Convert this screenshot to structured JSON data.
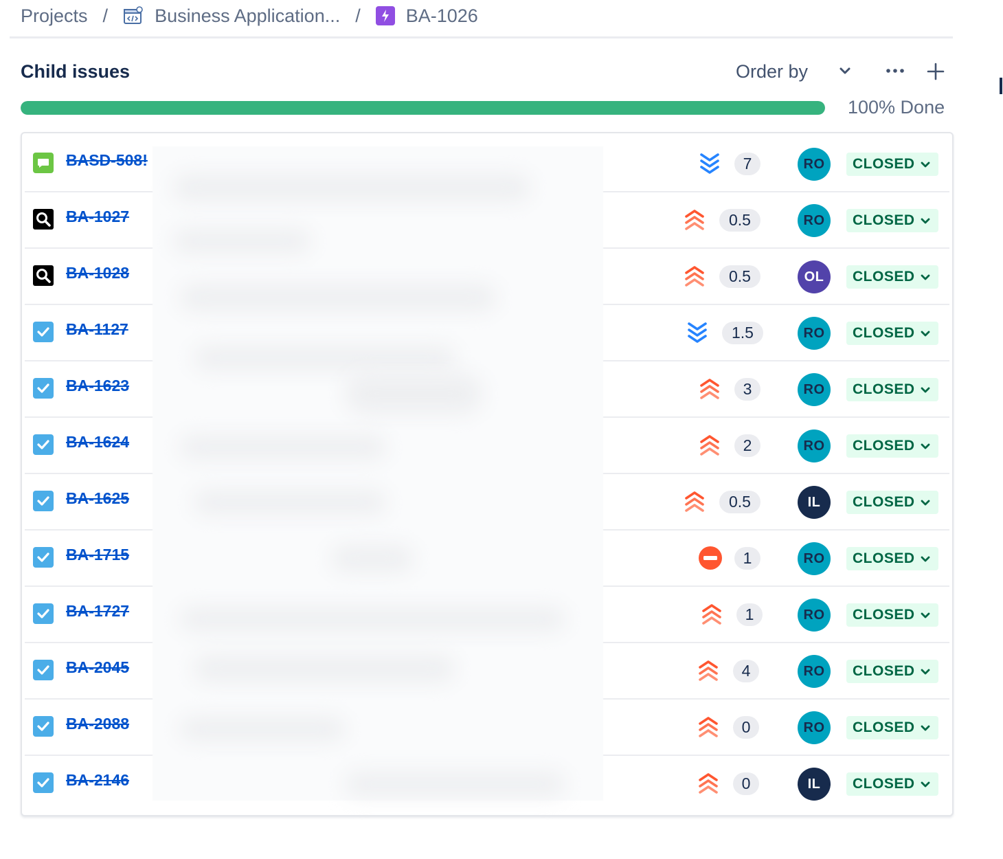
{
  "breadcrumb": {
    "projects": "Projects",
    "separator": "/",
    "project": "Business Application...",
    "issue": "BA-1026"
  },
  "child_issues": {
    "title": "Child issues",
    "order_by": "Order by",
    "progress_percent": 100,
    "progress_label": "100% Done",
    "colors": {
      "progress": "#36b37e",
      "status_bg": "#e3fcef",
      "status_text": "#006644",
      "link": "#0052cc"
    }
  },
  "rows": [
    {
      "key": "BASD-508!",
      "type": "request-icon",
      "priority": "lowest",
      "points": "7",
      "assignee": "RO",
      "status": "CLOSED"
    },
    {
      "key": "BA-1027",
      "type": "research-icon",
      "priority": "highest",
      "points": "0.5",
      "assignee": "RO",
      "status": "CLOSED"
    },
    {
      "key": "BA-1028",
      "type": "research-icon",
      "priority": "highest",
      "points": "0.5",
      "assignee": "OL",
      "status": "CLOSED"
    },
    {
      "key": "BA-1127",
      "type": "task-icon",
      "priority": "lowest",
      "points": "1.5",
      "assignee": "RO",
      "status": "CLOSED"
    },
    {
      "key": "BA-1623",
      "type": "task-icon",
      "priority": "highest",
      "points": "3",
      "assignee": "RO",
      "status": "CLOSED"
    },
    {
      "key": "BA-1624",
      "type": "task-icon",
      "priority": "highest",
      "points": "2",
      "assignee": "RO",
      "status": "CLOSED"
    },
    {
      "key": "BA-1625",
      "type": "task-icon",
      "priority": "highest",
      "points": "0.5",
      "assignee": "IL",
      "status": "CLOSED"
    },
    {
      "key": "BA-1715",
      "type": "task-icon",
      "priority": "blocker",
      "points": "1",
      "assignee": "RO",
      "status": "CLOSED"
    },
    {
      "key": "BA-1727",
      "type": "task-icon",
      "priority": "highest",
      "points": "1",
      "assignee": "RO",
      "status": "CLOSED"
    },
    {
      "key": "BA-2045",
      "type": "task-icon",
      "priority": "highest",
      "points": "4",
      "assignee": "RO",
      "status": "CLOSED"
    },
    {
      "key": "BA-2088",
      "type": "task-icon",
      "priority": "highest",
      "points": "0",
      "assignee": "RO",
      "status": "CLOSED"
    },
    {
      "key": "BA-2146",
      "type": "task-icon",
      "priority": "highest",
      "points": "0",
      "assignee": "IL",
      "status": "CLOSED"
    }
  ]
}
